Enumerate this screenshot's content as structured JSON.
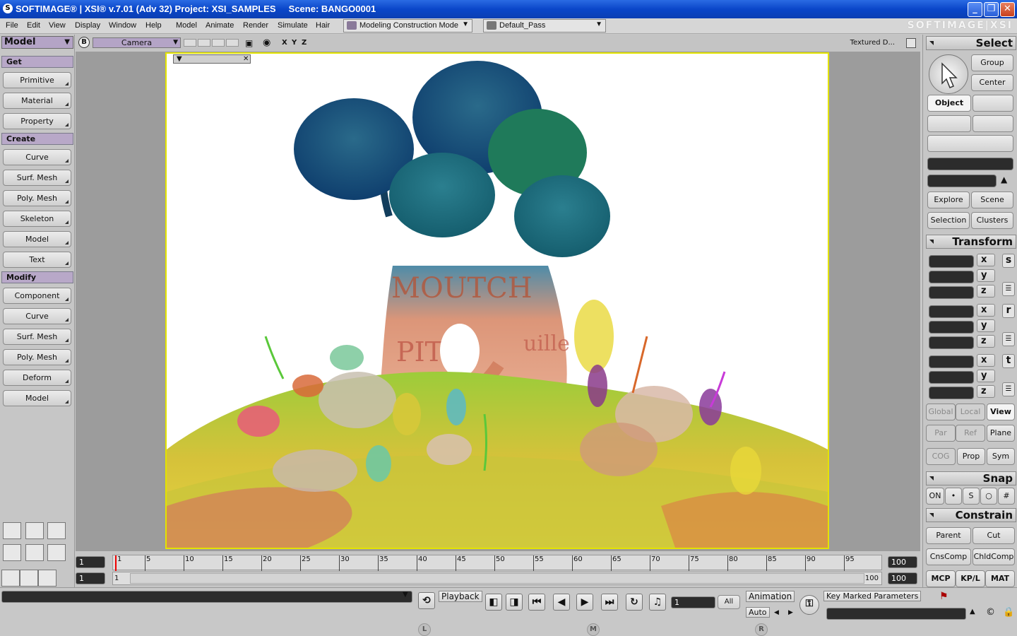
{
  "window": {
    "title": "SOFTIMAGE® | XSI® v.7.01 (Adv 32) Project: XSI_SAMPLES     Scene: BANGO0001",
    "min": "_",
    "max": "❐",
    "close": "✕"
  },
  "menu": {
    "items": [
      "File",
      "Edit",
      "View",
      "Display",
      "Window",
      "Help",
      "Model",
      "Animate",
      "Render",
      "Simulate",
      "Hair"
    ],
    "mode": "Modeling Construction Mode",
    "pass": "Default_Pass",
    "brand": "SOFTIMAGE|XSI"
  },
  "left": {
    "model_dropdown": "Model",
    "get_label": "Get",
    "get_items": [
      "Primitive",
      "Material",
      "Property"
    ],
    "create_label": "Create",
    "create_items": [
      "Curve",
      "Surf. Mesh",
      "Poly. Mesh",
      "Skeleton",
      "Model",
      "Text"
    ],
    "modify_label": "Modify",
    "modify_items": [
      "Component",
      "Curve",
      "Surf. Mesh",
      "Poly. Mesh",
      "Deform",
      "Model"
    ]
  },
  "viewport": {
    "b_label": "B",
    "camera": "Camera",
    "axes": [
      "X",
      "Y",
      "Z"
    ],
    "shading": "Textured D...",
    "scene_text_1": "MOUTCH",
    "scene_text_2": "PITR",
    "scene_text_3": "uille"
  },
  "right": {
    "select_title": "Select",
    "group": "Group",
    "center": "Center",
    "object": "Object",
    "explore": "Explore",
    "scene": "Scene",
    "selection": "Selection",
    "clusters": "Clusters",
    "transform_title": "Transform",
    "axes": [
      "x",
      "y",
      "z"
    ],
    "scale": "s",
    "rotate": "r",
    "translate": "t",
    "global": "Global",
    "local": "Local",
    "view": "View",
    "par": "Par",
    "ref": "Ref",
    "plane": "Plane",
    "cog": "COG",
    "prop": "Prop",
    "sym": "Sym",
    "snap_title": "Snap",
    "snap_on": "ON",
    "constrain_title": "Constrain",
    "parent": "Parent",
    "cut": "Cut",
    "cnscomp": "CnsComp",
    "chldcomp": "ChldComp",
    "mcp": "MCP",
    "kpl": "KP/L",
    "mat": "MAT"
  },
  "timeline": {
    "start": "1",
    "end": "100",
    "range_start": "1",
    "range_end_a": "1",
    "range_end_b": "100",
    "range_end_c": "100",
    "ticks": [
      "1",
      "5",
      "10",
      "15",
      "20",
      "25",
      "30",
      "35",
      "40",
      "45",
      "50",
      "55",
      "60",
      "65",
      "70",
      "75",
      "80",
      "85",
      "90",
      "95"
    ]
  },
  "bottom": {
    "playback": "Playback",
    "frame": "1",
    "all": "All",
    "animation": "Animation",
    "auto": "Auto",
    "key_marked": "Key Marked Parameters",
    "tabs": [
      "L",
      "M",
      "R"
    ]
  }
}
